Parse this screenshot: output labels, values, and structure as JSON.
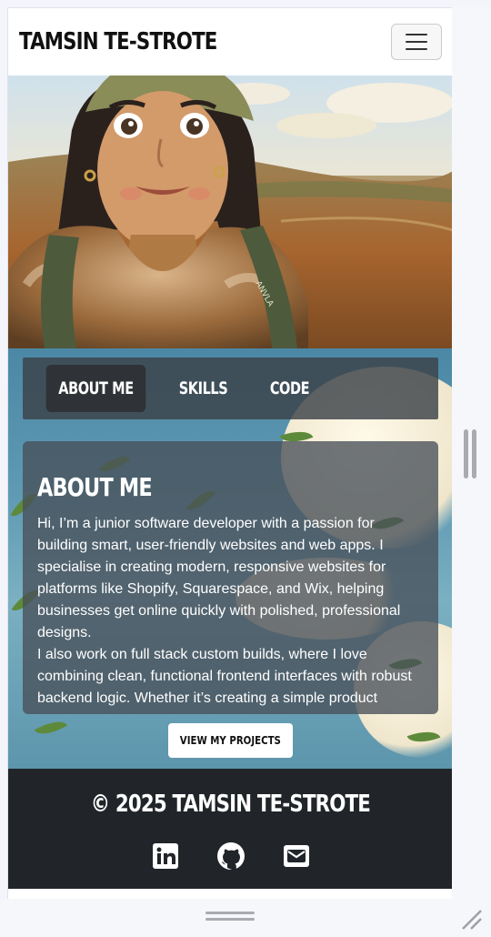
{
  "header": {
    "brand": "TAMSIN TE-STROTE",
    "menu_icon": "hamburger-icon"
  },
  "hero": {
    "image": "illustrated-portrait-in-moorland"
  },
  "tabs": [
    {
      "label": "ABOUT ME",
      "active": true
    },
    {
      "label": "SKILLS",
      "active": false
    },
    {
      "label": "CODE",
      "active": false
    }
  ],
  "about": {
    "heading": "ABOUT ME",
    "paragraph_1": "Hi, I’m a junior software developer with a passion for building smart, user-friendly websites and web apps. I specialise in creating modern, responsive websites for platforms like Shopify, Squarespace, and Wix, helping businesses get online quickly with polished, professional designs.",
    "paragraph_2": "I also work on full stack custom builds, where I love combining clean, functional frontend interfaces with robust backend logic. Whether it’s creating a simple product"
  },
  "cta": {
    "label": "VIEW MY PROJECTS"
  },
  "footer": {
    "copyright": "© 2025 TAMSIN TE-STROTE",
    "socials": [
      "linkedin-icon",
      "github-icon",
      "email-icon"
    ]
  },
  "colors": {
    "footer_bg": "#212529",
    "tab_bar_bg": "#3c4248",
    "card_bg": "#485058"
  }
}
